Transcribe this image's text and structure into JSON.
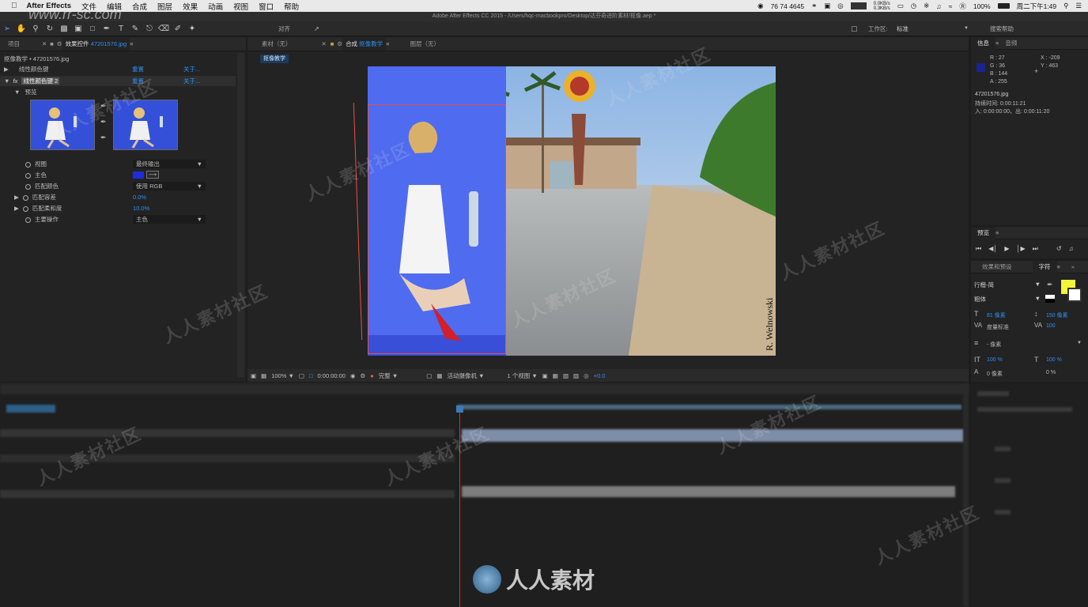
{
  "menubar": {
    "apple": "",
    "app_name": "After Effects",
    "items": [
      "文件",
      "编辑",
      "合成",
      "图层",
      "效果",
      "动画",
      "视图",
      "窗口",
      "帮助"
    ],
    "status_numbers": "76 74 4645",
    "network": "0.0KB/s",
    "network2": "0.3KB/s",
    "battery": "100%",
    "clock": "周二下午1:49"
  },
  "window": {
    "title": "Adobe After Effects CC 2015 - /Users/hqc-macbookpro/Desktop/达芬奇进阶素材/抠像.aep *"
  },
  "toolbar": {
    "align_label": "对齐",
    "workspace_label": "工作区:",
    "workspace_value": "标准",
    "search_placeholder": "搜索帮助"
  },
  "project_panel": {
    "tab_project": "项目",
    "tab_effects": "效果控件",
    "tab_effects_file": "47201576.jpg",
    "breadcrumb": "抠像教学 • 47201576.jpg",
    "effects": [
      {
        "name": "线性颜色键",
        "reset": "重置",
        "about": "关于..."
      },
      {
        "name": "线性颜色键 2",
        "reset": "重置",
        "about": "关于..."
      }
    ],
    "preview_label": "预览",
    "params": [
      {
        "label": "视图",
        "value": "最终输出"
      },
      {
        "label": "主色",
        "value": ""
      },
      {
        "label": "匹配颜色",
        "value": "使用 RGB"
      },
      {
        "label": "匹配容差",
        "value": "0.0%"
      },
      {
        "label": "匹配柔和度",
        "value": "10.0%"
      },
      {
        "label": "主要操作",
        "value": "主色"
      }
    ],
    "key_color": "#1e2cdc"
  },
  "viewer": {
    "tab_footage": "素材（无）",
    "tab_comp": "合成",
    "tab_comp_name": "抠像教学",
    "tab_layer": "图层（无）",
    "comp_button": "抠像教学",
    "photo_credit": "R. Welnowski",
    "footer": {
      "zoom": "100%",
      "timecode": "0:00:00:00",
      "resolution": "完整",
      "camera": "活动摄像机",
      "views": "1 个视图",
      "exposure": "+0.0"
    }
  },
  "info_panel": {
    "tab_info": "信息",
    "tab_audio": "音频",
    "r": "R : 27",
    "g": "G : 36",
    "b": "B : 144",
    "a": "A : 255",
    "x": "X : -209",
    "y": "Y : 463",
    "swatch": "#1b2490",
    "file": "47201576.jpg",
    "duration": "持续时间: 0:00:11:21",
    "in_out": "入: 0:00:00:00，出: 0:00:11:20"
  },
  "preview_panel": {
    "title": "预览"
  },
  "char_panel": {
    "tab_effects_presets": "效果和预设",
    "tab_character": "字符",
    "font": "行楷-简",
    "style": "粗体",
    "size": "81 像素",
    "leading": "150 像素",
    "kerning": "度量标准",
    "tracking": "100",
    "stroke": "- 像素",
    "v_scale": "100 %",
    "h_scale": "100 %",
    "baseline": "0 像素",
    "tsume": "0 %",
    "fill_color": "#f4f43c"
  },
  "watermark": {
    "site": "www.rr-sc.com",
    "tile": "人人素材社区",
    "logo": "人人素材"
  }
}
